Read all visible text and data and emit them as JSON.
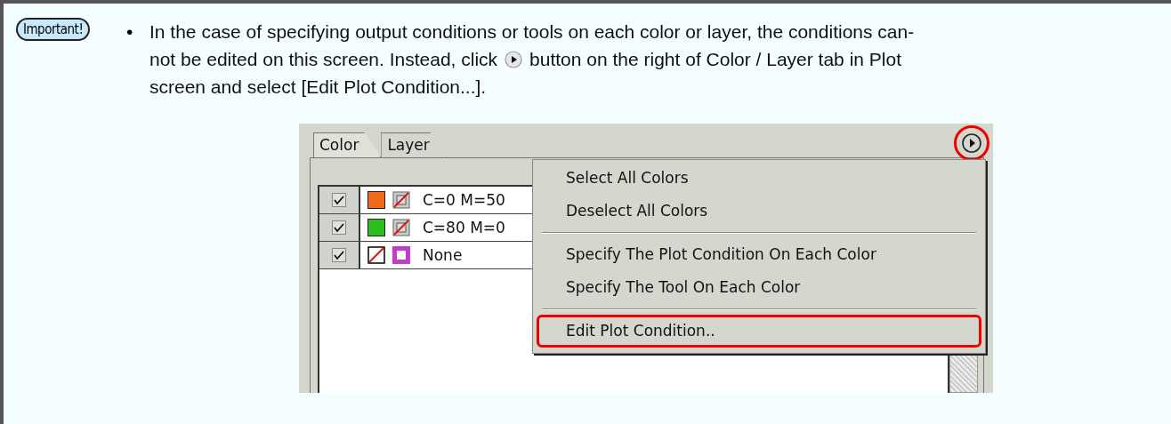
{
  "badge": "Important!",
  "bullet": "•",
  "lines": [
    {
      "before": "In the case of specifying output conditions or tools on each color or layer, the conditions can-"
    },
    {
      "before": "not be edited on this screen. Instead, click",
      "icon": true,
      "after": "button on the right of Color / Layer tab in Plot"
    },
    {
      "before": "screen and select [Edit Plot Condition...]."
    }
  ],
  "panel": {
    "tabs": [
      {
        "label": "Color",
        "selected": true
      },
      {
        "label": "Layer",
        "selected": false
      }
    ],
    "rows": [
      {
        "checked": true,
        "fill": {
          "kind": "swatch",
          "color": "#f06a1e"
        },
        "stroke": {
          "kind": "none"
        },
        "name": "C=0 M=50"
      },
      {
        "checked": true,
        "fill": {
          "kind": "swatch",
          "color": "#2fbf1c"
        },
        "stroke": {
          "kind": "none"
        },
        "name": "C=80 M=0"
      },
      {
        "checked": true,
        "fill": {
          "kind": "none"
        },
        "stroke": {
          "kind": "swatch",
          "color": "#c23cc8"
        },
        "name": "None"
      }
    ],
    "menu_button_highlighted": true,
    "menu": [
      {
        "kind": "item",
        "label": "Select All Colors",
        "highlighted": false
      },
      {
        "kind": "item",
        "label": "Deselect All Colors",
        "highlighted": false
      },
      {
        "kind": "separator"
      },
      {
        "kind": "item",
        "label": "Specify The Plot Condition On Each Color",
        "highlighted": false
      },
      {
        "kind": "item",
        "label": "Specify The Tool On Each Color",
        "highlighted": false
      },
      {
        "kind": "separator"
      },
      {
        "kind": "item",
        "label": "Edit Plot Condition..",
        "highlighted": true
      }
    ]
  }
}
